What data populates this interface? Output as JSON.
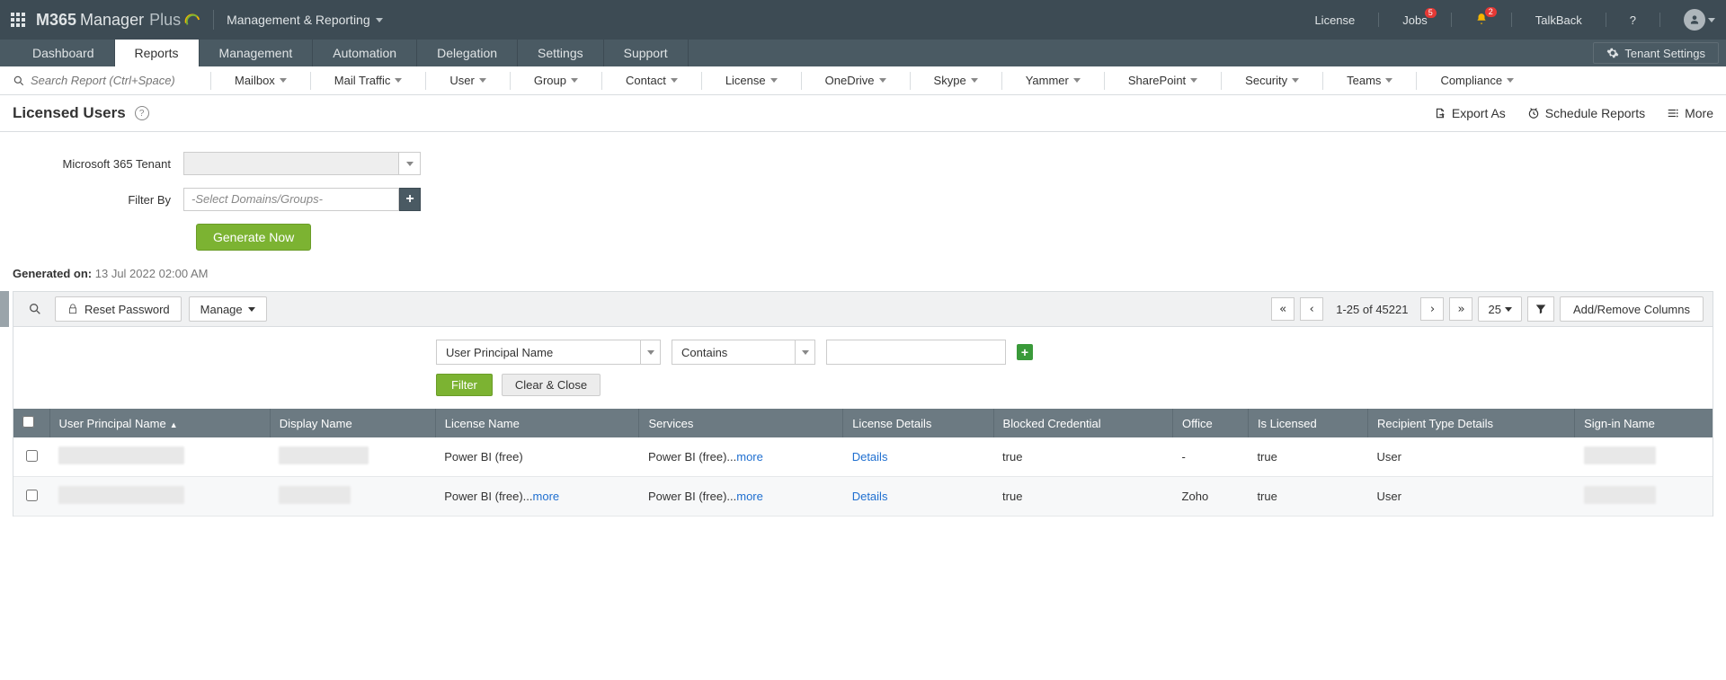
{
  "header": {
    "brand_pre": "M365",
    "brand_main": "Manager",
    "brand_suffix": "Plus",
    "top_dropdown": "Management & Reporting",
    "links": {
      "license": "License",
      "jobs": "Jobs",
      "talkback": "TalkBack"
    },
    "badges": {
      "jobs": "5",
      "bell": "2"
    }
  },
  "tabs": [
    "Dashboard",
    "Reports",
    "Management",
    "Automation",
    "Delegation",
    "Settings",
    "Support"
  ],
  "tenant_settings": "Tenant Settings",
  "search_placeholder": "Search Report (Ctrl+Space)",
  "subnav": [
    "Mailbox",
    "Mail Traffic",
    "User",
    "Group",
    "Contact",
    "License",
    "OneDrive",
    "Skype",
    "Yammer",
    "SharePoint",
    "Security",
    "Teams",
    "Compliance"
  ],
  "page": {
    "title": "Licensed Users",
    "export_as": "Export As",
    "schedule_reports": "Schedule Reports",
    "more": "More"
  },
  "filters": {
    "tenant_label": "Microsoft 365 Tenant",
    "filter_by_label": "Filter By",
    "filter_by_placeholder": "-Select Domains/Groups-",
    "generate": "Generate Now"
  },
  "generated_on": {
    "label": "Generated on:",
    "value": "13 Jul 2022 02:00 AM"
  },
  "toolbar": {
    "reset_password": "Reset Password",
    "manage": "Manage",
    "pager_text": "1-25 of 45221",
    "page_size": "25",
    "add_remove": "Add/Remove Columns"
  },
  "filter_builder": {
    "field": "User Principal Name",
    "operator": "Contains",
    "filter_btn": "Filter",
    "clear_btn": "Clear & Close"
  },
  "columns": {
    "upn": "User Principal Name",
    "display_name": "Display Name",
    "license_name": "License Name",
    "services": "Services",
    "license_details": "License Details",
    "blocked": "Blocked Credential",
    "office": "Office",
    "is_licensed": "Is Licensed",
    "recipient_type": "Recipient Type Details",
    "signin_name": "Sign-in Name"
  },
  "rows": [
    {
      "license_name": "Power BI (free)",
      "services_pre": "Power BI (free)...",
      "services_more": "more",
      "details": "Details",
      "blocked": "true",
      "office": "-",
      "is_licensed": "true",
      "recipient_type": "User"
    },
    {
      "license_name_pre": "Power BI (free)...",
      "license_name_more": "more",
      "services_pre": "Power BI (free)...",
      "services_more": "more",
      "details": "Details",
      "blocked": "true",
      "office": "Zoho",
      "is_licensed": "true",
      "recipient_type": "User"
    }
  ]
}
